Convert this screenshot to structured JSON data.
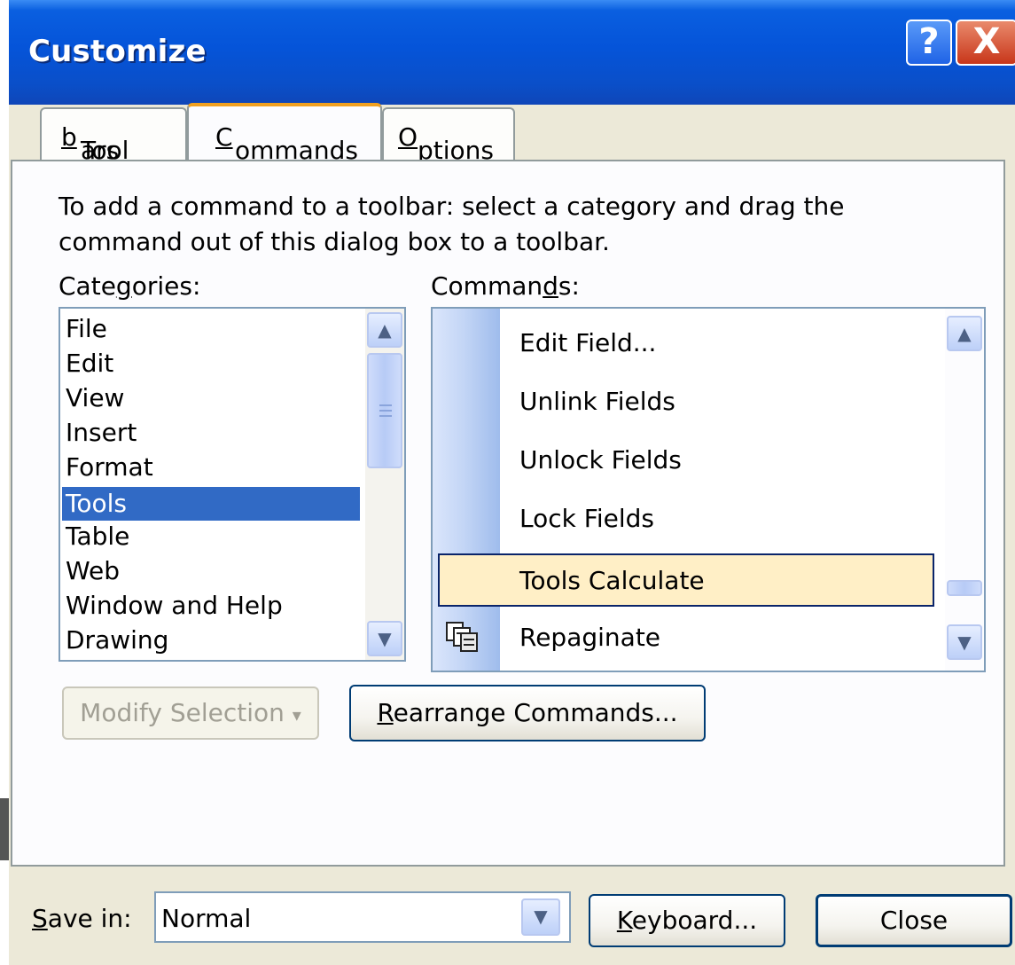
{
  "window": {
    "title": "Customize",
    "help_glyph": "?",
    "close_glyph": "X"
  },
  "tabs": [
    {
      "pre": "Tool",
      "key": "b",
      "post": "ars"
    },
    {
      "pre": "",
      "key": "C",
      "post": "ommands"
    },
    {
      "pre": "",
      "key": "O",
      "post": "ptions"
    }
  ],
  "active_tab": "Commands",
  "instructions": {
    "line1": "To add a command to a toolbar: select a category and drag the",
    "line2": "command out of this dialog box to a toolbar."
  },
  "categories": {
    "label_pre": "Cate",
    "label_key": "g",
    "label_post": "ories:",
    "items": [
      "File",
      "Edit",
      "View",
      "Insert",
      "Format",
      "Tools",
      "Table",
      "Web",
      "Window and Help",
      "Drawing"
    ],
    "selected": "Tools"
  },
  "commands": {
    "label_pre": "Comman",
    "label_key": "d",
    "label_post": "s:",
    "items": [
      "Edit Field...",
      "Unlink Fields",
      "Unlock Fields",
      "Lock Fields",
      "Tools Calculate",
      "Repaginate"
    ],
    "highlighted": "Tools Calculate"
  },
  "buttons": {
    "modify_selection": "Modify Selection",
    "modify_arrow": "▾",
    "rearrange_key": "R",
    "rearrange_rest": "earrange Commands...",
    "keyboard_key": "K",
    "keyboard_rest": "eyboard...",
    "close": "Close"
  },
  "save_in": {
    "label_key": "S",
    "label_rest": "ave in:",
    "value": "Normal"
  },
  "icons": {
    "scroll_up": "up-arrow-icon",
    "scroll_down": "down-arrow-icon",
    "repaginate": "repaginate-icon"
  },
  "colors": {
    "title_bar": "#0554d9",
    "selection": "#316ac5",
    "highlight_fill": "#ffefc6",
    "highlight_border": "#0a246a",
    "tab_accent": "#f0a020"
  }
}
